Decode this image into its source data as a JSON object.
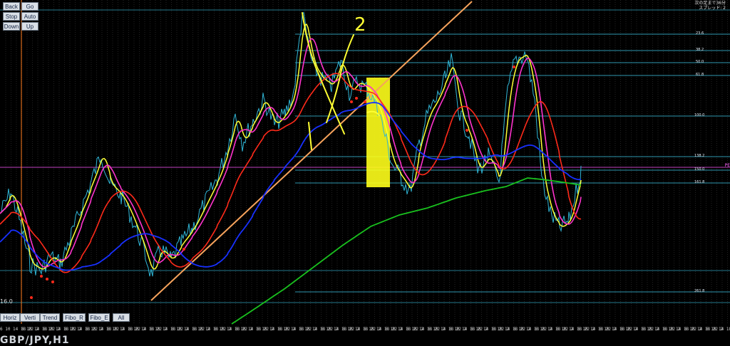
{
  "nav_buttons": [
    {
      "label": "Back"
    },
    {
      "label": "Go"
    },
    {
      "label": "Stop"
    },
    {
      "label": "Auto"
    },
    {
      "label": "Down"
    },
    {
      "label": "Up"
    }
  ],
  "toolbar_buttons": [
    {
      "label": "Horiz"
    },
    {
      "label": "Verti"
    },
    {
      "label": "Trend"
    },
    {
      "label": "Fibo_R"
    },
    {
      "label": "Fibo_E"
    },
    {
      "label": "All"
    }
  ],
  "corner_text": {
    "line1": "次の足まで36分",
    "line2": "スプレッド: 2"
  },
  "zoom_label": "16.0",
  "pe_label": "PE",
  "fib_levels": [
    "23.6",
    "38.2",
    "50.0",
    "61.8",
    "100.0",
    "138.2",
    "150.0",
    "161.8",
    "261.8"
  ],
  "annotation_text": "2",
  "symbol_title": "GBP/JPY,H1",
  "time_axis_labels": [
    "6 10 14 18 22 2",
    "6 10 14 18 22 2",
    "6 10 14 18 22 2",
    "6 10 14 18 22 2",
    "6 10 14 18 22 2",
    "6 10 14 18 22 2",
    "6 10 14 18 22 2",
    "6 10 14 18 22 2",
    "6 10 14 18 22 2",
    "6 10 14 18 22 2",
    "6 10 14 18 22 2",
    "6 10 14 18 22 2",
    "6 10 14 18 22 2",
    "6 10 14 18 22 2",
    "6 10 14 18 22 2",
    "6 10 14 18 22 2",
    "6 10 14 18 22 2",
    "6 10 14 18 22 2",
    "6 10 14 18 22 2",
    "6 10 14 18 22 2",
    "6 10 14 18 22 2",
    "6 10 14 18 22 2",
    "6 10 14 18 22 2",
    "6 10 14 18 22 2",
    "6 10 14 18 22 2",
    "6 10 14 18 22 2",
    "6 10 14 18 22 2",
    "6 10 14 18 22 2",
    "6 10 14 18 22 2",
    "6 10 14 18 22 2",
    "6 10 14 18 22 2",
    "6 10 14 18 22 2",
    "6 10 14 18 22 2",
    "6 10 14 18 22 2"
  ],
  "colors": {
    "background": "#000000",
    "price_line": "#2fb6d6",
    "ma_fast": "#ffff33",
    "ma_mid": "#ff33cc",
    "ma_slow": "#ff2a1a",
    "ma_long": "#1830ff",
    "ma_longest": "#19c21e",
    "trendline": "#f7a35c",
    "highlight": "#ffff1a",
    "fib": "#3ec8e8",
    "hline_magenta": "#c040c0",
    "vline_orange": "#ff7a1a"
  }
}
